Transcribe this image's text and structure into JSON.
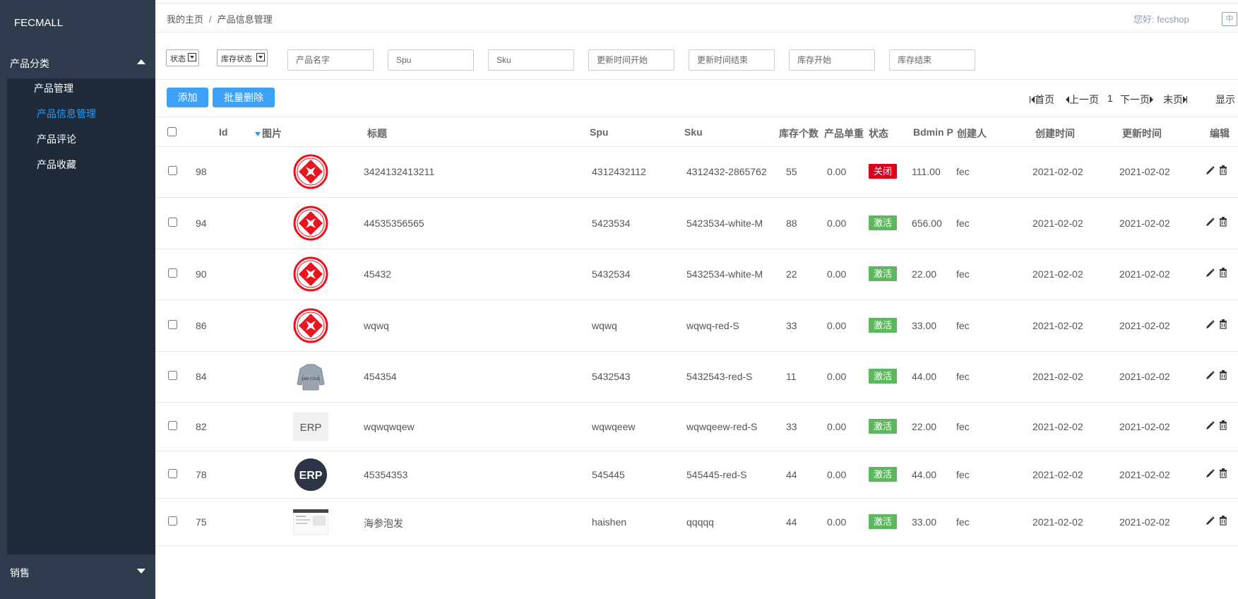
{
  "sidebar": {
    "brand": "FECMALL",
    "section_label": "产品分类",
    "items": [
      "产品管理",
      "产品信息管理",
      "产品评论",
      "产品收藏"
    ],
    "bottom_label": "销售"
  },
  "topbar": {
    "breadcrumb_home": "我的主页",
    "breadcrumb_sep": "/",
    "breadcrumb_current": "产品信息管理",
    "greeting": "您好: fecshop",
    "lang": "中"
  },
  "filters": {
    "status_select": "状态",
    "stock_status_select": "库存状态",
    "inputs": [
      "产品名字",
      "Spu",
      "Sku",
      "更新时间开始",
      "更新时间结束",
      "库存开始",
      "库存结束"
    ]
  },
  "actions": {
    "add": "添加",
    "batch_delete": "批量删除"
  },
  "pager": {
    "first": "首页",
    "prev": "上一页",
    "current": "1",
    "next": "下一页",
    "last": "末页",
    "show": "显示"
  },
  "table": {
    "headers": {
      "id": "Id",
      "image": "图片",
      "title": "标题",
      "spu": "Spu",
      "sku": "Sku",
      "stock": "库存个数",
      "price": "产品单重",
      "status": "状态",
      "bdmin": "Bdmin P",
      "creator": "创建人",
      "created": "创建时间",
      "updated": "更新时间",
      "edit": "编辑"
    },
    "rows": [
      {
        "id": "98",
        "title": "3424132413211",
        "spu": "4312432112",
        "sku": "4312432-2865762",
        "stock": "55",
        "price": "0.00",
        "status": "关闭",
        "bdmin": "111.00",
        "creator": "fec",
        "created": "2021-02-02",
        "updated": "2021-02-02"
      },
      {
        "id": "94",
        "title": "44535356565",
        "spu": "5423534",
        "sku": "5423534-white-M",
        "stock": "88",
        "price": "0.00",
        "status": "激活",
        "bdmin": "656.00",
        "creator": "fec",
        "created": "2021-02-02",
        "updated": "2021-02-02"
      },
      {
        "id": "90",
        "title": "45432",
        "spu": "5432534",
        "sku": "5432534-white-M",
        "stock": "22",
        "price": "0.00",
        "status": "激活",
        "bdmin": "22.00",
        "creator": "fec",
        "created": "2021-02-02",
        "updated": "2021-02-02"
      },
      {
        "id": "86",
        "title": "wqwq",
        "spu": "wqwq",
        "sku": "wqwq-red-S",
        "stock": "33",
        "price": "0.00",
        "status": "激活",
        "bdmin": "33.00",
        "creator": "fec",
        "created": "2021-02-02",
        "updated": "2021-02-02"
      },
      {
        "id": "84",
        "title": "454354",
        "spu": "5432543",
        "sku": "5432543-red-S",
        "stock": "11",
        "price": "0.00",
        "status": "激活",
        "bdmin": "44.00",
        "creator": "fec",
        "created": "2021-02-02",
        "updated": "2021-02-02"
      },
      {
        "id": "82",
        "title": "wqwqwqew",
        "spu": "wqwqeew",
        "sku": "wqwqeew-red-S",
        "stock": "33",
        "price": "0.00",
        "status": "激活",
        "bdmin": "22.00",
        "creator": "fec",
        "created": "2021-02-02",
        "updated": "2021-02-02"
      },
      {
        "id": "78",
        "title": "45354353",
        "spu": "545445",
        "sku": "545445-red-S",
        "stock": "44",
        "price": "0.00",
        "status": "激活",
        "bdmin": "44.00",
        "creator": "fec",
        "created": "2021-02-02",
        "updated": "2021-02-02"
      },
      {
        "id": "75",
        "title": "海参泡发",
        "spu": "haishen",
        "sku": "qqqqq",
        "stock": "44",
        "price": "0.00",
        "status": "激活",
        "bdmin": "33.00",
        "creator": "fec",
        "created": "2021-02-02",
        "updated": "2021-02-02"
      }
    ]
  },
  "thumb_text": {
    "erp": "ERP",
    "sweater": "I AM COLD"
  },
  "colors": {
    "sidebar_bg": "#2f3c4d",
    "submenu_bg": "#1f2b3b",
    "active_link": "#1e9fff",
    "primary_button": "#3da2f5",
    "status_closed": "#d9001b",
    "status_active": "#5cb85c"
  }
}
